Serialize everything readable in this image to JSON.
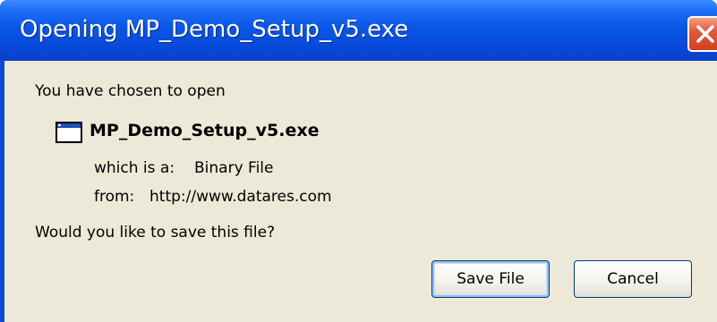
{
  "window": {
    "title": "Opening MP_Demo_Setup_v5.exe",
    "close_icon": "close-icon",
    "colors": {
      "titlebar": "#0a56e6",
      "close_button": "#d2401f",
      "client_background": "#ece9d8"
    }
  },
  "dialog": {
    "intro": "You have chosen to open",
    "file_icon": "application-window-icon",
    "filename": "MP_Demo_Setup_v5.exe",
    "type_label": "which is a:",
    "type_value": "Binary File",
    "from_label": "from:",
    "from_value": "http://www.datares.com",
    "question": "Would you like to save this file?"
  },
  "buttons": {
    "save_label": "Save File",
    "cancel_label": "Cancel"
  }
}
